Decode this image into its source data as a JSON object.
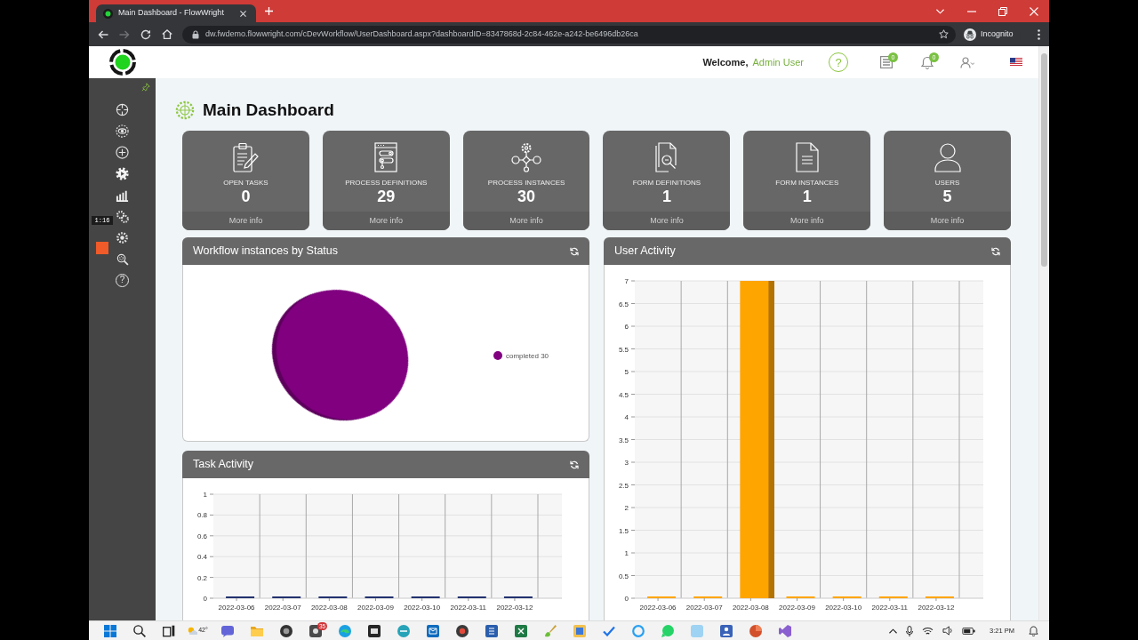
{
  "browser": {
    "tab_title": "Main Dashboard - FlowWright",
    "url": "dw.fwdemo.flowwright.com/cDevWorkflow/UserDashboard.aspx?dashboardID=8347868d-2c84-462e-a242-be6496db26ca",
    "forward_disabled": true,
    "profile_label": "Incognito"
  },
  "header": {
    "welcome": "Welcome,",
    "user_name": "Admin User",
    "help": "?",
    "list_count": "0",
    "bell_count": "0"
  },
  "sidebar": {
    "help": "?"
  },
  "recorder": {
    "timer": "1:16"
  },
  "page_title": "Main Dashboard",
  "cards": [
    {
      "label": "OPEN TASKS",
      "value": "0",
      "link": "More info"
    },
    {
      "label": "PROCESS DEFINITIONS",
      "value": "29",
      "link": "More info"
    },
    {
      "label": "PROCESS INSTANCES",
      "value": "30",
      "link": "More info"
    },
    {
      "label": "FORM DEFINITIONS",
      "value": "1",
      "link": "More info"
    },
    {
      "label": "FORM INSTANCES",
      "value": "1",
      "link": "More info"
    },
    {
      "label": "USERS",
      "value": "5",
      "link": "More info"
    }
  ],
  "panels": [
    {
      "title": "Workflow instances by Status",
      "chart_data": {
        "type": "pie",
        "categories": [
          "completed 30"
        ],
        "values": [
          30
        ],
        "colors": [
          "#800080"
        ],
        "legend": "right"
      }
    },
    {
      "title": "Task Activity",
      "chart_data": {
        "type": "bar",
        "categories": [
          "2022-03-06",
          "2022-03-07",
          "2022-03-08",
          "2022-03-09",
          "2022-03-10",
          "2022-03-11",
          "2022-03-12"
        ],
        "values": [
          0,
          0,
          0,
          0,
          0,
          0,
          0
        ],
        "color": "#23336e",
        "ylim": [
          0,
          1
        ],
        "yticks": [
          0,
          0.2,
          0.4,
          0.6,
          0.8,
          1
        ],
        "grid": true
      }
    },
    {
      "title": "User Activity",
      "chart_data": {
        "type": "bar",
        "categories": [
          "2022-03-06",
          "2022-03-07",
          "2022-03-08",
          "2022-03-09",
          "2022-03-10",
          "2022-03-11",
          "2022-03-12"
        ],
        "values": [
          0,
          0,
          7,
          0,
          0,
          0,
          0
        ],
        "color": "#ffa500",
        "ylim": [
          0,
          7
        ],
        "yticks": [
          0,
          0.5,
          1,
          1.5,
          2,
          2.5,
          3,
          3.5,
          4,
          4.5,
          5,
          5.5,
          6,
          6.5,
          7
        ],
        "grid": true
      }
    }
  ],
  "taskbar": {
    "weather": "42°",
    "badge": "35",
    "time": "3:21 PM"
  }
}
